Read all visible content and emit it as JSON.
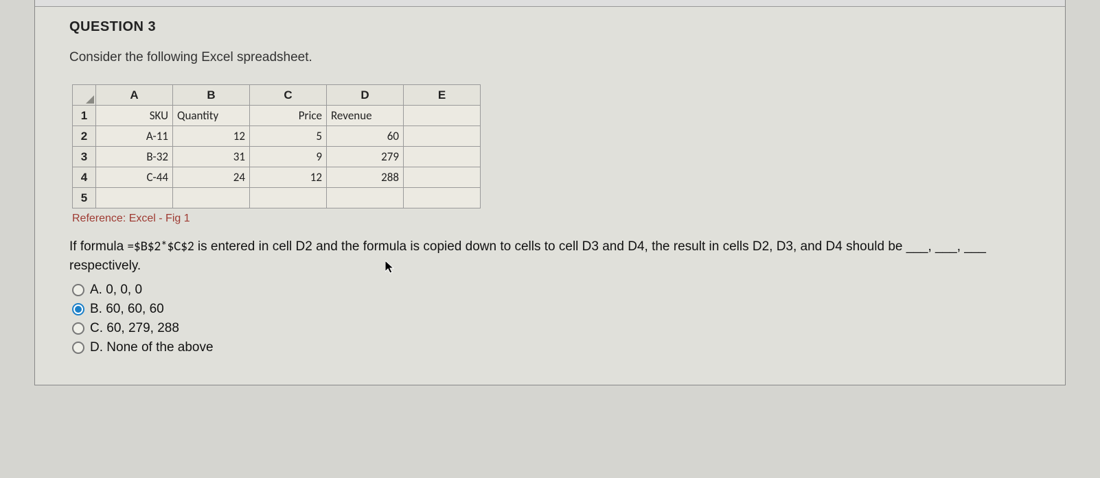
{
  "question": {
    "title": "QUESTION 3",
    "lead": "Consider the following Excel spreadsheet.",
    "reference": "Reference: Excel - Fig 1",
    "stem_pre": "If formula ",
    "formula": "=$B$2*$C$2",
    "stem_post": " is entered in cell D2 and the formula is copied down to cells to cell D3 and D4, the result in cells D2, D3, and D4 should be ___, ___, ___ respectively."
  },
  "spreadsheet": {
    "columns": [
      "A",
      "B",
      "C",
      "D",
      "E"
    ],
    "row_headers": [
      "1",
      "2",
      "3",
      "4",
      "5"
    ],
    "cells": {
      "r1": {
        "A": "SKU",
        "B": "Quantity",
        "C": "Price",
        "D": "Revenue",
        "E": ""
      },
      "r2": {
        "A": "A-11",
        "B": "12",
        "C": "5",
        "D": "60",
        "E": ""
      },
      "r3": {
        "A": "B-32",
        "B": "31",
        "C": "9",
        "D": "279",
        "E": ""
      },
      "r4": {
        "A": "C-44",
        "B": "24",
        "C": "12",
        "D": "288",
        "E": ""
      },
      "r5": {
        "A": "",
        "B": "",
        "C": "",
        "D": "",
        "E": ""
      }
    }
  },
  "options": {
    "a": "A. 0, 0, 0",
    "b": "B. 60, 60, 60",
    "c": "C. 60, 279, 288",
    "d": "D. None of the above"
  },
  "selected": "b",
  "chart_data": {
    "type": "table",
    "title": "Excel spreadsheet",
    "columns": [
      "SKU",
      "Quantity",
      "Price",
      "Revenue"
    ],
    "rows": [
      {
        "SKU": "A-11",
        "Quantity": 12,
        "Price": 5,
        "Revenue": 60
      },
      {
        "SKU": "B-32",
        "Quantity": 31,
        "Price": 9,
        "Revenue": 279
      },
      {
        "SKU": "C-44",
        "Quantity": 24,
        "Price": 12,
        "Revenue": 288
      }
    ]
  }
}
